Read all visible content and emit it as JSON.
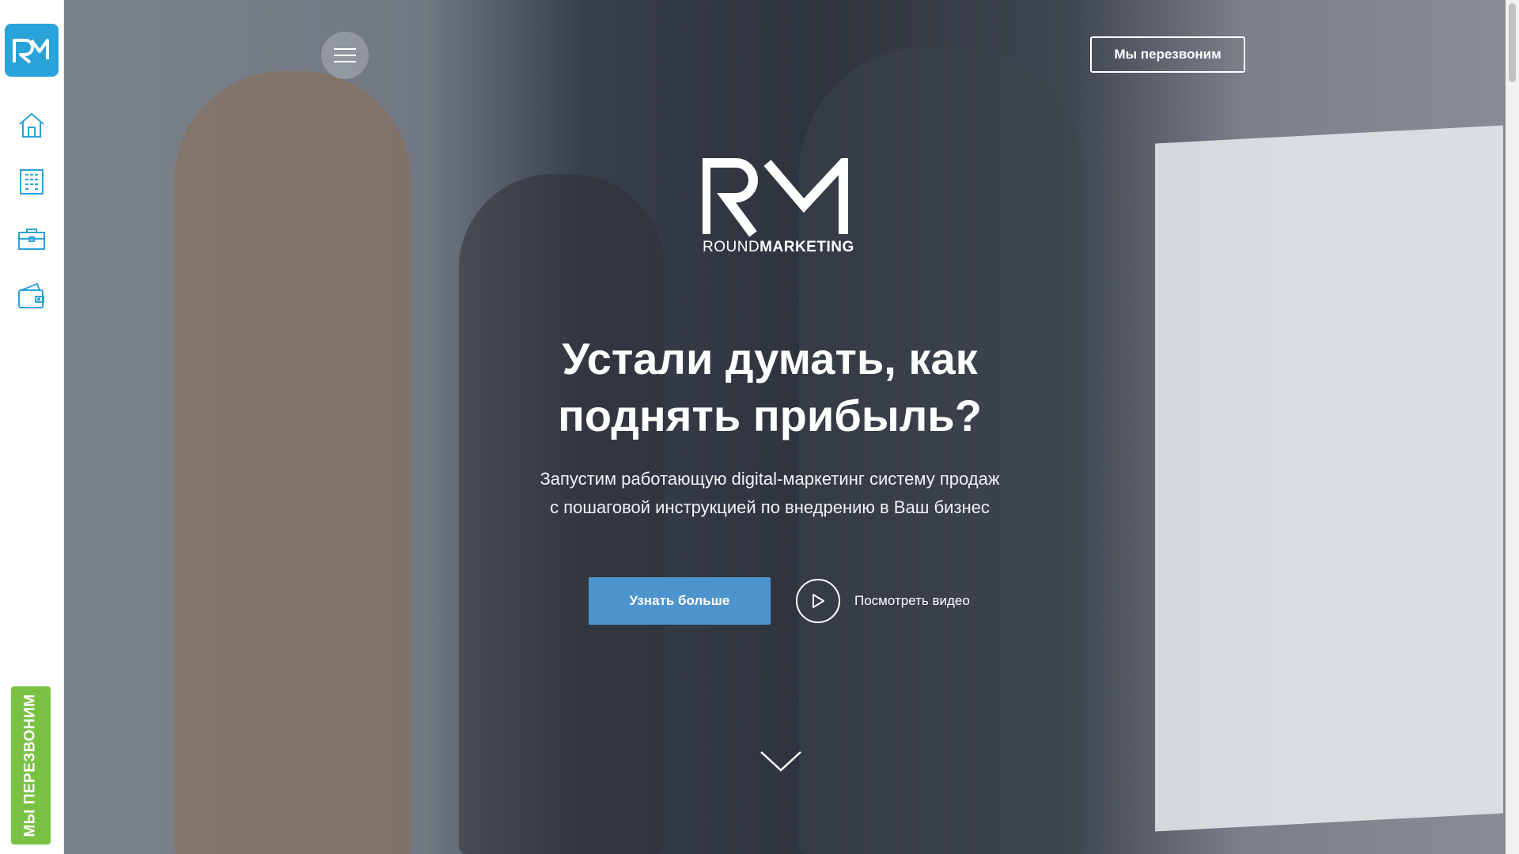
{
  "sidebar": {
    "logo_icon": "rm-logo-icon",
    "items": [
      {
        "icon": "home-icon"
      },
      {
        "icon": "building-icon"
      },
      {
        "icon": "briefcase-icon"
      },
      {
        "icon": "wallet-icon"
      }
    ],
    "callback_vertical_label": "МЫ ПЕРЕЗВОНИМ",
    "accent_color": "#2aa3d8",
    "cta_color": "#79c143"
  },
  "header": {
    "menu_icon": "hamburger-icon",
    "callback_button_label": "Мы перезвоним"
  },
  "brand": {
    "round": "ROUND",
    "marketing": "MARKETING"
  },
  "hero": {
    "headline": "Устали думать, как поднять прибыль?",
    "subline_1": "Запустим работающую digital-маркетинг систему продаж",
    "subline_2": "с пошаговой инструкцией по внедрению в Ваш бизнес",
    "learn_more_label": "Узнать больше",
    "watch_video_label": "Посмотреть видео",
    "button_color": "#4d94cf",
    "scroll_icon": "chevron-down-icon"
  }
}
